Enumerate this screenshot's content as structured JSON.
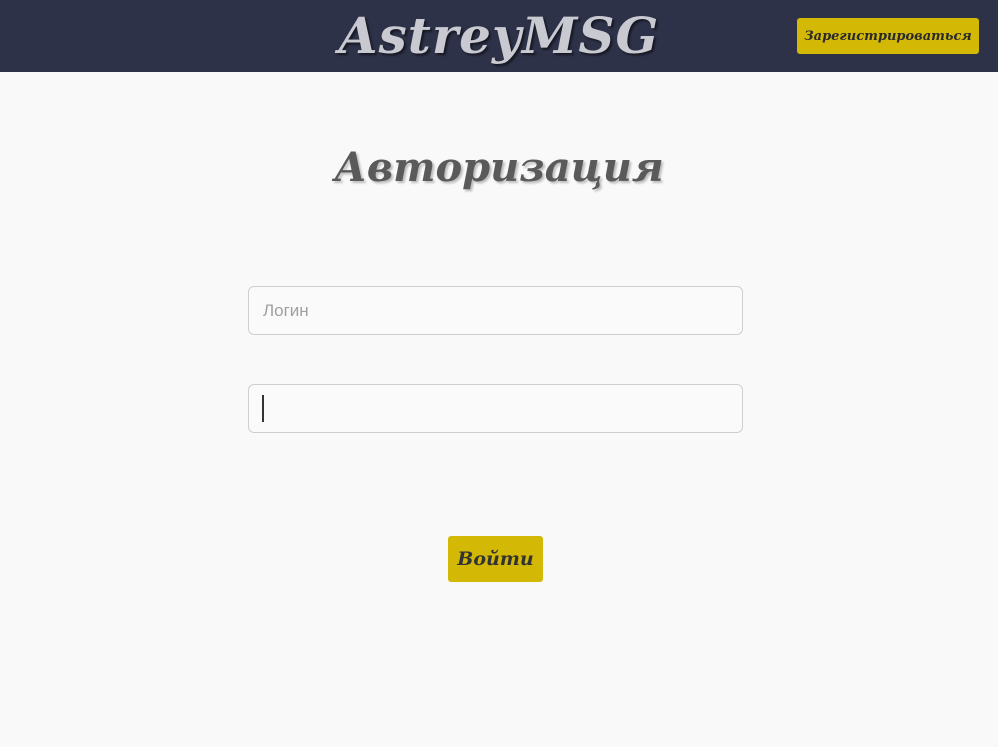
{
  "header": {
    "brand": "AstreyMSG",
    "register_label": "Зарегистрироваться"
  },
  "main": {
    "title": "Авторизация",
    "login": {
      "placeholder": "Логин",
      "value": ""
    },
    "password": {
      "placeholder": "",
      "value": ""
    },
    "submit_label": "Войти"
  },
  "colors": {
    "header_bg": "#2e3248",
    "accent": "#d3b905",
    "page_bg": "#f9f9f9"
  }
}
